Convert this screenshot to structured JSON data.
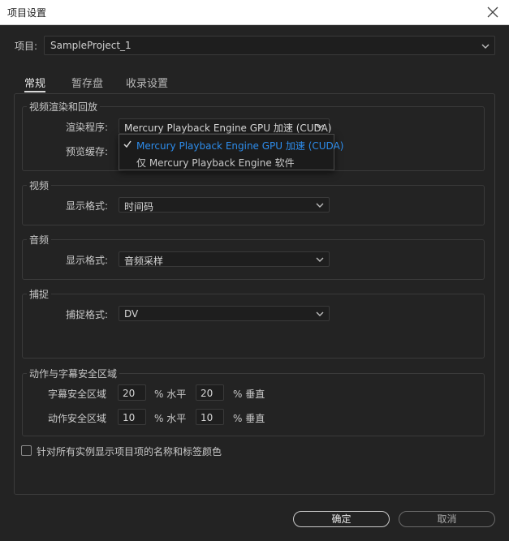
{
  "window": {
    "title": "项目设置"
  },
  "project": {
    "label": "项目:",
    "value": "SampleProject_1"
  },
  "tabs": [
    {
      "label": "常规",
      "active": true
    },
    {
      "label": "暂存盘",
      "active": false
    },
    {
      "label": "收录设置",
      "active": false
    }
  ],
  "video_render": {
    "title": "视频渲染和回放",
    "renderer_label": "渲染程序:",
    "renderer_value": "Mercury Playback Engine GPU 加速 (CUDA)",
    "preview_cache_label": "预览缓存:",
    "renderer_options": [
      {
        "label": "Mercury Playback Engine GPU 加速 (CUDA)",
        "selected": true
      },
      {
        "label": "仅 Mercury Playback Engine 软件",
        "selected": false
      }
    ]
  },
  "video": {
    "title": "视频",
    "format_label": "显示格式:",
    "format_value": "时间码"
  },
  "audio": {
    "title": "音频",
    "format_label": "显示格式:",
    "format_value": "音频采样"
  },
  "capture": {
    "title": "捕捉",
    "format_label": "捕捉格式:",
    "format_value": "DV"
  },
  "safe_margins": {
    "title": "动作与字幕安全区域",
    "title_safe": {
      "label": "字幕安全区域",
      "h": "20",
      "h_unit": "% 水平",
      "v": "20",
      "v_unit": "% 垂直"
    },
    "action_safe": {
      "label": "动作安全区域",
      "h": "10",
      "h_unit": "% 水平",
      "v": "10",
      "v_unit": "% 垂直"
    }
  },
  "show_names_checkbox": {
    "label": "针对所有实例显示项目项的名称和标签颜色",
    "checked": false
  },
  "buttons": {
    "ok": "确定",
    "cancel": "取消"
  },
  "colors": {
    "background": "#232323",
    "accent": "#2d8ceb",
    "titlebar": "#ffffff"
  }
}
